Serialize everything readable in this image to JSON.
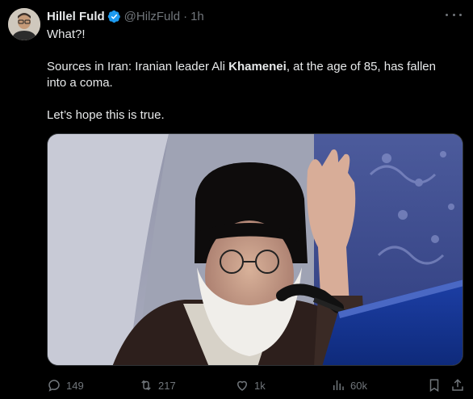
{
  "tweet": {
    "author_name": "Hillel Fuld",
    "author_handle": "@HilzFuld",
    "separator": "·",
    "time": "1h",
    "text_line1": "What?!",
    "text_line2_pre": "Sources in Iran: Iranian leader Ali ",
    "text_line2_bold": "Khamenei",
    "text_line2_post": ", at the age of 85, has fallen into a coma.",
    "text_line3": "Let’s hope this is true."
  },
  "actions": {
    "replies": "149",
    "reposts": "217",
    "likes": "1k",
    "views": "60k"
  },
  "colors": {
    "background": "#000000",
    "text": "#e7e9ea",
    "muted": "#71767b",
    "verified": "#1d9bf0"
  },
  "icons": [
    "verified-badge-icon",
    "more-icon",
    "reply-icon",
    "repost-icon",
    "like-icon",
    "views-icon",
    "bookmark-icon",
    "share-icon"
  ]
}
